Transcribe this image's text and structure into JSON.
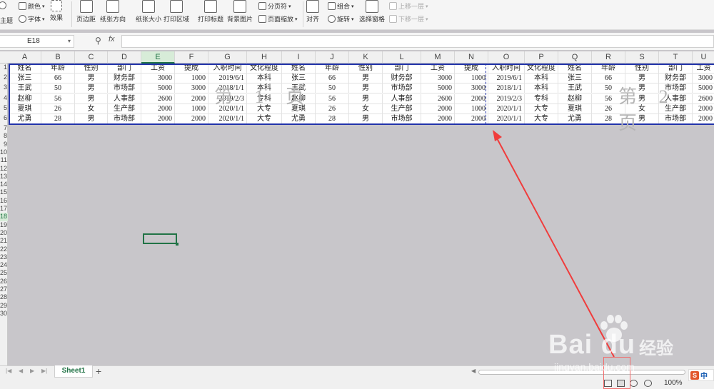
{
  "toolbar": {
    "theme": "主题",
    "colors": "颜色",
    "fonts": "字体",
    "effects": "效果",
    "margins": "页边距",
    "orientation": "纸张方向",
    "size": "纸张大小",
    "print_area": "打印区域",
    "print_titles": "打印标题",
    "background": "背景图片",
    "page_break": "分页符",
    "page_scale": "页面缩放",
    "align": "对齐",
    "group": "组合",
    "rotate": "旋转",
    "selection_pane": "选择窗格",
    "bring_forward": "上移一层",
    "send_backward": "下移一层"
  },
  "formula_bar": {
    "name_box": "E18",
    "fx": "fx",
    "formula": ""
  },
  "columns": [
    "A",
    "B",
    "C",
    "D",
    "E",
    "F",
    "G",
    "H",
    "I",
    "J",
    "K",
    "L",
    "M",
    "N",
    "O",
    "P",
    "Q",
    "R",
    "S",
    "T",
    "U"
  ],
  "selected_column": "E",
  "rows": [
    "1",
    "2",
    "3",
    "4",
    "5",
    "6",
    "7",
    "8",
    "9",
    "10",
    "11",
    "12",
    "13",
    "14",
    "15",
    "16",
    "17",
    "18",
    "19",
    "20",
    "21",
    "22",
    "23",
    "24",
    "25",
    "26",
    "27",
    "28",
    "29",
    "30"
  ],
  "selected_row": "18",
  "table": {
    "header": [
      "姓名",
      "年龄",
      "性别",
      "部门",
      "工资",
      "提成",
      "入职时间",
      "文化程度",
      "姓名",
      "年龄",
      "性别",
      "部门",
      "工资",
      "提成",
      "入职时间",
      "文化程度",
      "姓名",
      "年龄",
      "性别",
      "部门",
      "工资"
    ],
    "rows": [
      [
        "张三",
        "66",
        "男",
        "财务部",
        "3000",
        "1000",
        "2019/6/1",
        "本科",
        "张三",
        "66",
        "男",
        "财务部",
        "3000",
        "1000",
        "2019/6/1",
        "本科",
        "张三",
        "66",
        "男",
        "财务部",
        "3000"
      ],
      [
        "王武",
        "50",
        "男",
        "市场部",
        "5000",
        "3000",
        "2018/1/1",
        "本科",
        "王武",
        "50",
        "男",
        "市场部",
        "5000",
        "3000",
        "2018/1/1",
        "本科",
        "王武",
        "50",
        "男",
        "市场部",
        "5000"
      ],
      [
        "赵柳",
        "56",
        "男",
        "人事部",
        "2600",
        "2000",
        "2019/2/3",
        "专科",
        "赵柳",
        "56",
        "男",
        "人事部",
        "2600",
        "2000",
        "2019/2/3",
        "专科",
        "赵柳",
        "56",
        "男",
        "人事部",
        "2600"
      ],
      [
        "夏琪",
        "26",
        "女",
        "生产部",
        "2000",
        "1000",
        "2020/1/1",
        "大专",
        "夏琪",
        "26",
        "女",
        "生产部",
        "2000",
        "1000",
        "2020/1/1",
        "大专",
        "夏琪",
        "26",
        "女",
        "生产部",
        "2000"
      ],
      [
        "尤勇",
        "28",
        "男",
        "市场部",
        "2000",
        "2000",
        "2020/1/1",
        "大专",
        "尤勇",
        "28",
        "男",
        "市场部",
        "2000",
        "2000",
        "2020/1/1",
        "大专",
        "尤勇",
        "28",
        "男",
        "市场部",
        "2000"
      ]
    ]
  },
  "page_marks": [
    "第 1 页",
    "第 2 页"
  ],
  "sheet_tab": "Sheet1",
  "add_tab": "+",
  "zoom": "100%",
  "watermark": {
    "logo": "Bai  du",
    "cn": "经验",
    "url": "jingyan.baidu.com"
  },
  "ime": {
    "logo": "S",
    "lang": "中"
  },
  "colors": {
    "accent": "#217346",
    "page_break": "#2233aa",
    "annotation": "#f03c3c"
  }
}
